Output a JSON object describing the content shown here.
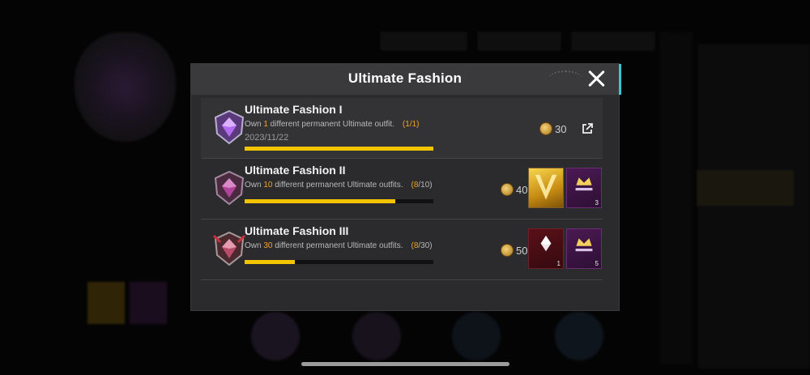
{
  "modal": {
    "title": "Ultimate Fashion"
  },
  "achievements": [
    {
      "name": "Ultimate Fashion I",
      "desc_pre": "Own ",
      "desc_num": "1",
      "desc_post": " different permanent Ultimate outfit.",
      "prog_open": "(",
      "prog_current": "1",
      "prog_total": "/1)",
      "date": "2023/11/22",
      "progress": 1.0,
      "points": "30",
      "rewards": []
    },
    {
      "name": "Ultimate Fashion II",
      "desc_pre": "Own ",
      "desc_num": "10",
      "desc_post": " different permanent Ultimate outfits.",
      "prog_open": "(",
      "prog_current": "8",
      "prog_total": "/10)",
      "date": "",
      "progress": 0.8,
      "points": "40",
      "rewards": [
        {
          "type": "gold-emblem",
          "count": ""
        },
        {
          "type": "ultimate-crate",
          "count": "3"
        }
      ]
    },
    {
      "name": "Ultimate Fashion III",
      "desc_pre": "Own ",
      "desc_num": "30",
      "desc_post": " different permanent Ultimate outfits.",
      "prog_open": "(",
      "prog_current": "8",
      "prog_total": "/30)",
      "date": "",
      "progress": 0.2667,
      "points": "50",
      "rewards": [
        {
          "type": "ultimate-emblem",
          "count": "1"
        },
        {
          "type": "ultimate-crate",
          "count": "5"
        }
      ]
    }
  ],
  "colors": {
    "accent_orange": "#f1a428",
    "progress_yellow": "#f3c400",
    "edge_cyan": "#35c7d8"
  }
}
